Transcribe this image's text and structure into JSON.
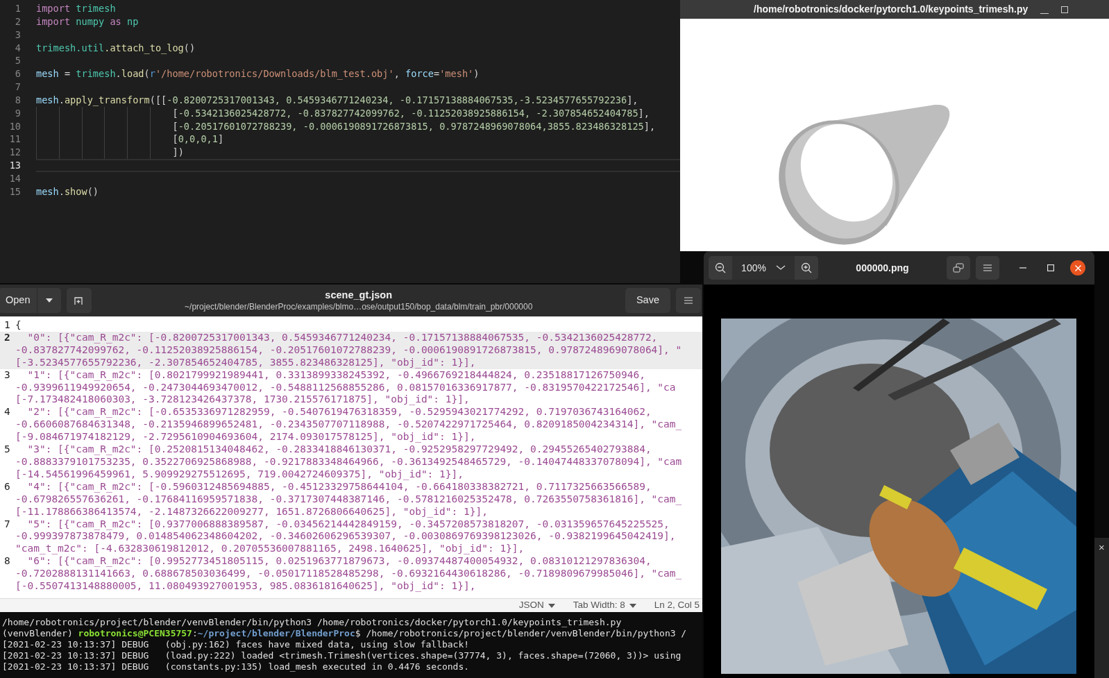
{
  "code_editor": {
    "lines": [
      {
        "number": "1",
        "current": false,
        "indented": false,
        "tokens": [
          {
            "kind": "keyword",
            "text": "import "
          },
          {
            "kind": "module",
            "text": "trimesh"
          }
        ]
      },
      {
        "number": "2",
        "current": false,
        "indented": false,
        "tokens": [
          {
            "kind": "keyword",
            "text": "import "
          },
          {
            "kind": "module",
            "text": "numpy "
          },
          {
            "kind": "keyword",
            "text": "as "
          },
          {
            "kind": "module",
            "text": "np"
          }
        ]
      },
      {
        "number": "3",
        "current": false,
        "indented": false
      },
      {
        "number": "4",
        "current": false,
        "indented": false,
        "tokens": [
          {
            "kind": "module",
            "text": "trimesh.util"
          },
          {
            "kind": "func",
            "text": ".attach_to_log"
          },
          {
            "kind": "plain",
            "text": "()"
          }
        ]
      },
      {
        "number": "5",
        "current": false,
        "indented": false
      },
      {
        "number": "6",
        "current": false,
        "indented": false,
        "tokens": [
          {
            "kind": "name",
            "text": "mesh"
          },
          {
            "kind": "plain",
            "text": " = "
          },
          {
            "kind": "module",
            "text": "trimesh"
          },
          {
            "kind": "plain",
            "text": "."
          },
          {
            "kind": "func",
            "text": "load"
          },
          {
            "kind": "plain",
            "text": "("
          },
          {
            "kind": "prefix",
            "text": "r"
          },
          {
            "kind": "string",
            "text": "'/home/robotronics/Downloads/blm_test.obj'"
          },
          {
            "kind": "plain",
            "text": ", "
          },
          {
            "kind": "name",
            "text": "force"
          },
          {
            "kind": "plain",
            "text": "="
          },
          {
            "kind": "string",
            "text": "'mesh'"
          },
          {
            "kind": "plain",
            "text": ")"
          }
        ]
      },
      {
        "number": "7",
        "current": false,
        "indented": false
      },
      {
        "number": "8",
        "current": false,
        "indented": false,
        "tokens": [
          {
            "kind": "name",
            "text": "mesh"
          },
          {
            "kind": "plain",
            "text": "."
          },
          {
            "kind": "func",
            "text": "apply_transform"
          },
          {
            "kind": "plain",
            "text": "([["
          },
          {
            "kind": "number",
            "text": "-0.8200725317001343, 0.5459346771240234, -0.17157138884067535,-3.5234577655792236"
          },
          {
            "kind": "plain",
            "text": "],"
          }
        ]
      },
      {
        "number": "9",
        "current": false,
        "indented": true,
        "tokens": [
          {
            "kind": "plain",
            "text": "["
          },
          {
            "kind": "number",
            "text": "-0.5342136025428772, -0.837827742099762, -0.11252038925886154, -2.307854652404785"
          },
          {
            "kind": "plain",
            "text": "],"
          }
        ]
      },
      {
        "number": "10",
        "current": false,
        "indented": true,
        "tokens": [
          {
            "kind": "plain",
            "text": "["
          },
          {
            "kind": "number",
            "text": "-0.20517601072788239, -0.0006190891726873815, 0.9787248969078064,3855.823486328125"
          },
          {
            "kind": "plain",
            "text": "],"
          }
        ]
      },
      {
        "number": "11",
        "current": false,
        "indented": true,
        "tokens": [
          {
            "kind": "plain",
            "text": "["
          },
          {
            "kind": "number",
            "text": "0,0,0,1"
          },
          {
            "kind": "plain",
            "text": "]"
          }
        ]
      },
      {
        "number": "12",
        "current": false,
        "indented": true,
        "tokens": [
          {
            "kind": "plain",
            "text": "])"
          }
        ]
      },
      {
        "number": "13",
        "current": true,
        "indented": false
      },
      {
        "number": "14",
        "current": false,
        "indented": false
      },
      {
        "number": "15",
        "current": false,
        "indented": false,
        "tokens": [
          {
            "kind": "name",
            "text": "mesh"
          },
          {
            "kind": "plain",
            "text": "."
          },
          {
            "kind": "func",
            "text": "show"
          },
          {
            "kind": "plain",
            "text": "()"
          }
        ]
      }
    ]
  },
  "mesh_viewer": {
    "title": "/home/robotronics/docker/pytorch1.0/keypoints_trimesh.py"
  },
  "text_editor": {
    "open_button": "Open",
    "title": "scene_gt.json",
    "path": "~/project/blender/BlenderProc/examples/blmo…ose/output150/bop_data/blm/train_pbr/000000",
    "save_button": "Save",
    "lines": [
      {
        "number": "1",
        "current": false,
        "rows": [
          "{"
        ]
      },
      {
        "number": "2",
        "current": true,
        "rows": [
          "  \"0\": [{\"cam_R_m2c\": [-0.8200725317001343, 0.5459346771240234, -0.17157138884067535, -0.5342136025428772,",
          "-0.837827742099762, -0.11252038925886154, -0.20517601072788239, -0.0006190891726873815, 0.9787248969078064], \"",
          "[-3.5234577655792236, -2.307854652404785, 3855.823486328125], \"obj_id\": 1}],"
        ]
      },
      {
        "number": "3",
        "current": false,
        "rows": [
          "  \"1\": [{\"cam_R_m2c\": [0.8021799921989441, 0.3313899338245392, -0.4966769218444824, 0.23518817126750946,",
          "-0.9399611949920654, -0.2473044693470012, -0.5488112568855286, 0.08157016336917877, -0.8319570422172546], \"ca",
          "[-7.173482418060303, -3.728123426437378, 1730.215576171875], \"obj_id\": 1}],"
        ]
      },
      {
        "number": "4",
        "current": false,
        "rows": [
          "  \"2\": [{\"cam_R_m2c\": [-0.6535336971282959, -0.5407619476318359, -0.5295943021774292, 0.7197036743164062,",
          "-0.6606087684631348, -0.2135946899652481, -0.2343507707118988, -0.5207422971725464, 0.8209185004234314], \"cam_",
          "[-9.084671974182129, -2.7295610904693604, 2174.093017578125], \"obj_id\": 1}],"
        ]
      },
      {
        "number": "5",
        "current": false,
        "rows": [
          "  \"3\": [{\"cam_R_m2c\": [0.2520815134048462, -0.2833418846130371, -0.9252958297729492, 0.29455265402793884,",
          "-0.8883379101753235, 0.3522706925868988, -0.9217883348464966, -0.3613492548465729, -0.14047448337078094], \"cam",
          "[-14.54561996459961, 5.909929275512695, 719.0042724609375], \"obj_id\": 1}],"
        ]
      },
      {
        "number": "6",
        "current": false,
        "rows": [
          "  \"4\": [{\"cam_R_m2c\": [-0.5960312485694885, -0.45123329758644104, -0.664180338382721, 0.7117325663566589,",
          "-0.679826557636261, -0.17684116959571838, -0.3717307448387146, -0.5781216025352478, 0.7263550758361816], \"cam_",
          "[-11.178866386413574, -2.1487326622009277, 1651.8726806640625], \"obj_id\": 1}],"
        ]
      },
      {
        "number": "7",
        "current": false,
        "rows": [
          "  \"5\": [{\"cam_R_m2c\": [0.9377006888389587, -0.03456214442849159, -0.3457208573818207, -0.031359657645225525,",
          "-0.999397873878479, 0.014854062348604202, -0.34602606296539307, -0.0030869769398123026, -0.9382199645042419],",
          "\"cam_t_m2c\": [-4.632830619812012, 0.20705536007881165, 2498.1640625], \"obj_id\": 1}],"
        ]
      },
      {
        "number": "8",
        "current": false,
        "rows": [
          "  \"6\": [{\"cam_R_m2c\": [0.9952773451805115, 0.0251963771879673, -0.09374487400054932, 0.08310121297836304,",
          "-0.7202888131141663, 0.688678503036499, -0.05017118528485298, -0.6932164430618286, -0.7189809679985046], \"cam_",
          "[-0.5507413148880005, 11.080493927001953, 985.0836181640625], \"obj_id\": 1}],"
        ]
      }
    ],
    "status_bar": {
      "language": "JSON",
      "tab_width": "Tab Width: 8",
      "position": "Ln 2, Col 5"
    }
  },
  "image_viewer": {
    "zoom": "100%",
    "title": "000000.png"
  },
  "terminal": {
    "lines": [
      [
        {
          "kind": "plain",
          "text": "/home/robotronics/project/blender/venvBlender/bin/python3 /home/robotronics/docker/pytorch1.0/keypoints_trimesh.py"
        }
      ],
      [
        {
          "kind": "plain",
          "text": "(venvBlender) "
        },
        {
          "kind": "user",
          "text": "robotronics@PCEN35757"
        },
        {
          "kind": "plain",
          "text": ":"
        },
        {
          "kind": "path",
          "text": "~/project/blender/BlenderProc"
        },
        {
          "kind": "plain",
          "text": "$ /home/robotronics/project/blender/venvBlender/bin/python3 /"
        }
      ],
      [
        {
          "kind": "plain",
          "text": "[2021-02-23 10:13:37] DEBUG   (obj.py:162) faces have mixed data, using slow fallback!"
        }
      ],
      [
        {
          "kind": "plain",
          "text": "[2021-02-23 10:13:37] DEBUG   (load.py:222) loaded <trimesh.Trimesh(vertices.shape=(37774, 3), faces.shape=(72060, 3))> using"
        }
      ],
      [
        {
          "kind": "plain",
          "text": "[2021-02-23 10:13:37] DEBUG   (constants.py:135) load_mesh executed in 0.4476 seconds."
        }
      ]
    ]
  },
  "side_panel": {
    "close_glyph": "×"
  }
}
